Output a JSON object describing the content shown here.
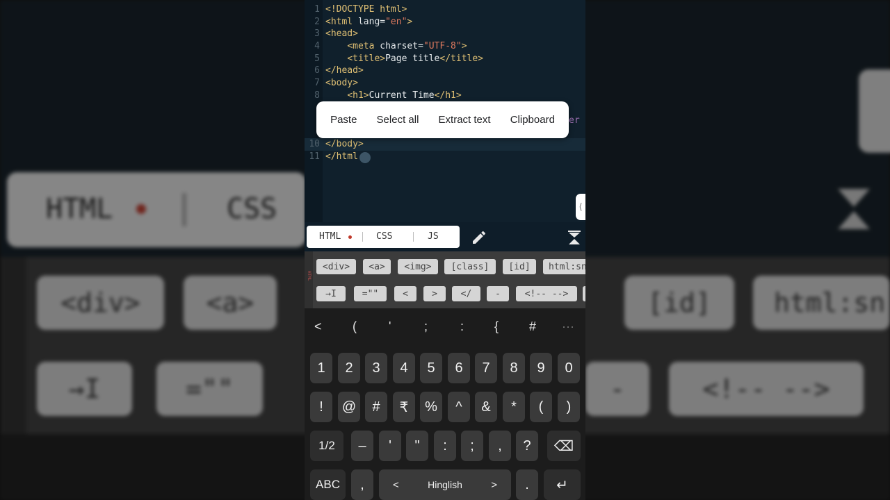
{
  "editor": {
    "lines": [
      {
        "n": "1",
        "html": "<span class=\"tag\">&lt;!DOCTYPE html&gt;</span>"
      },
      {
        "n": "2",
        "html": "<span class=\"tag\">&lt;html</span> <span class=\"attr\">lang=</span><span class=\"str\">\"en\"</span><span class=\"tag\">&gt;</span>"
      },
      {
        "n": "3",
        "html": "<span class=\"tag\">&lt;head&gt;</span>"
      },
      {
        "n": "4",
        "html": "    <span class=\"tag\">&lt;meta</span> <span class=\"attr\">charset=</span><span class=\"str\">\"UTF-8\"</span><span class=\"tag\">&gt;</span>"
      },
      {
        "n": "5",
        "html": "    <span class=\"tag\">&lt;title&gt;</span><span class=\"txtw\">Page title</span><span class=\"tag\">&lt;/title&gt;</span>"
      },
      {
        "n": "6",
        "html": "<span class=\"tag\">&lt;/head&gt;</span>"
      },
      {
        "n": "7",
        "html": "<span class=\"tag\">&lt;body&gt;</span>"
      },
      {
        "n": "8",
        "html": "    <span class=\"tag\">&lt;h1&gt;</span><span class=\"txtw\">Current Time</span><span class=\"tag\">&lt;/h1&gt;</span>"
      },
      {
        "n": "10",
        "html": "<span class=\"tag\">&lt;/body&gt;</span>"
      },
      {
        "n": "11",
        "html": "<span class=\"tag\">&lt;/html</span>"
      }
    ],
    "peek_text": "er"
  },
  "context_menu": {
    "paste": "Paste",
    "select_all": "Select all",
    "extract_text": "Extract text",
    "clipboard": "Clipboard"
  },
  "tabs": {
    "html": "HTML",
    "css": "CSS",
    "js": "JS"
  },
  "side_tab_glyph": "⟨",
  "chip_strip_label": "HTML",
  "chips_row1": [
    "<div>",
    "<a>",
    "<img>",
    "[class]",
    "[id]",
    "html:sn"
  ],
  "chips_row2": [
    "→I",
    "=\"\"",
    "<",
    ">",
    "</",
    "-",
    "<!-- -->"
  ],
  "keyboard": {
    "toolbar": [
      "<",
      "(",
      "'",
      ";",
      ":",
      "{",
      "#",
      "···"
    ],
    "row_digits": [
      "1",
      "2",
      "3",
      "4",
      "5",
      "6",
      "7",
      "8",
      "9",
      "0"
    ],
    "row_symbols": [
      "!",
      "@",
      "#",
      "₹",
      "%",
      "^",
      "&",
      "*",
      "(",
      ")"
    ],
    "row_third": {
      "page": "1/2",
      "keys": [
        "–",
        "'",
        "\"",
        ":",
        ";",
        ",",
        "?"
      ],
      "backspace": "⌫"
    },
    "row_bottom": {
      "abc": "ABC",
      "comma": ",",
      "left": "<",
      "space": "Hinglish",
      "right": ">",
      "period": ".",
      "enter": "↵"
    }
  },
  "background": {
    "tab_html": "HTML",
    "tab_css": "CSS",
    "chips_row1": [
      "<div>",
      "<a>",
      "[id]",
      "html:sn"
    ],
    "chips_row2": [
      "→I",
      "=\"\"",
      "-",
      "<!-- -->"
    ],
    "bottom": [
      "<",
      "(",
      "'",
      "{",
      "#",
      "···"
    ],
    "vert": "HTML"
  }
}
